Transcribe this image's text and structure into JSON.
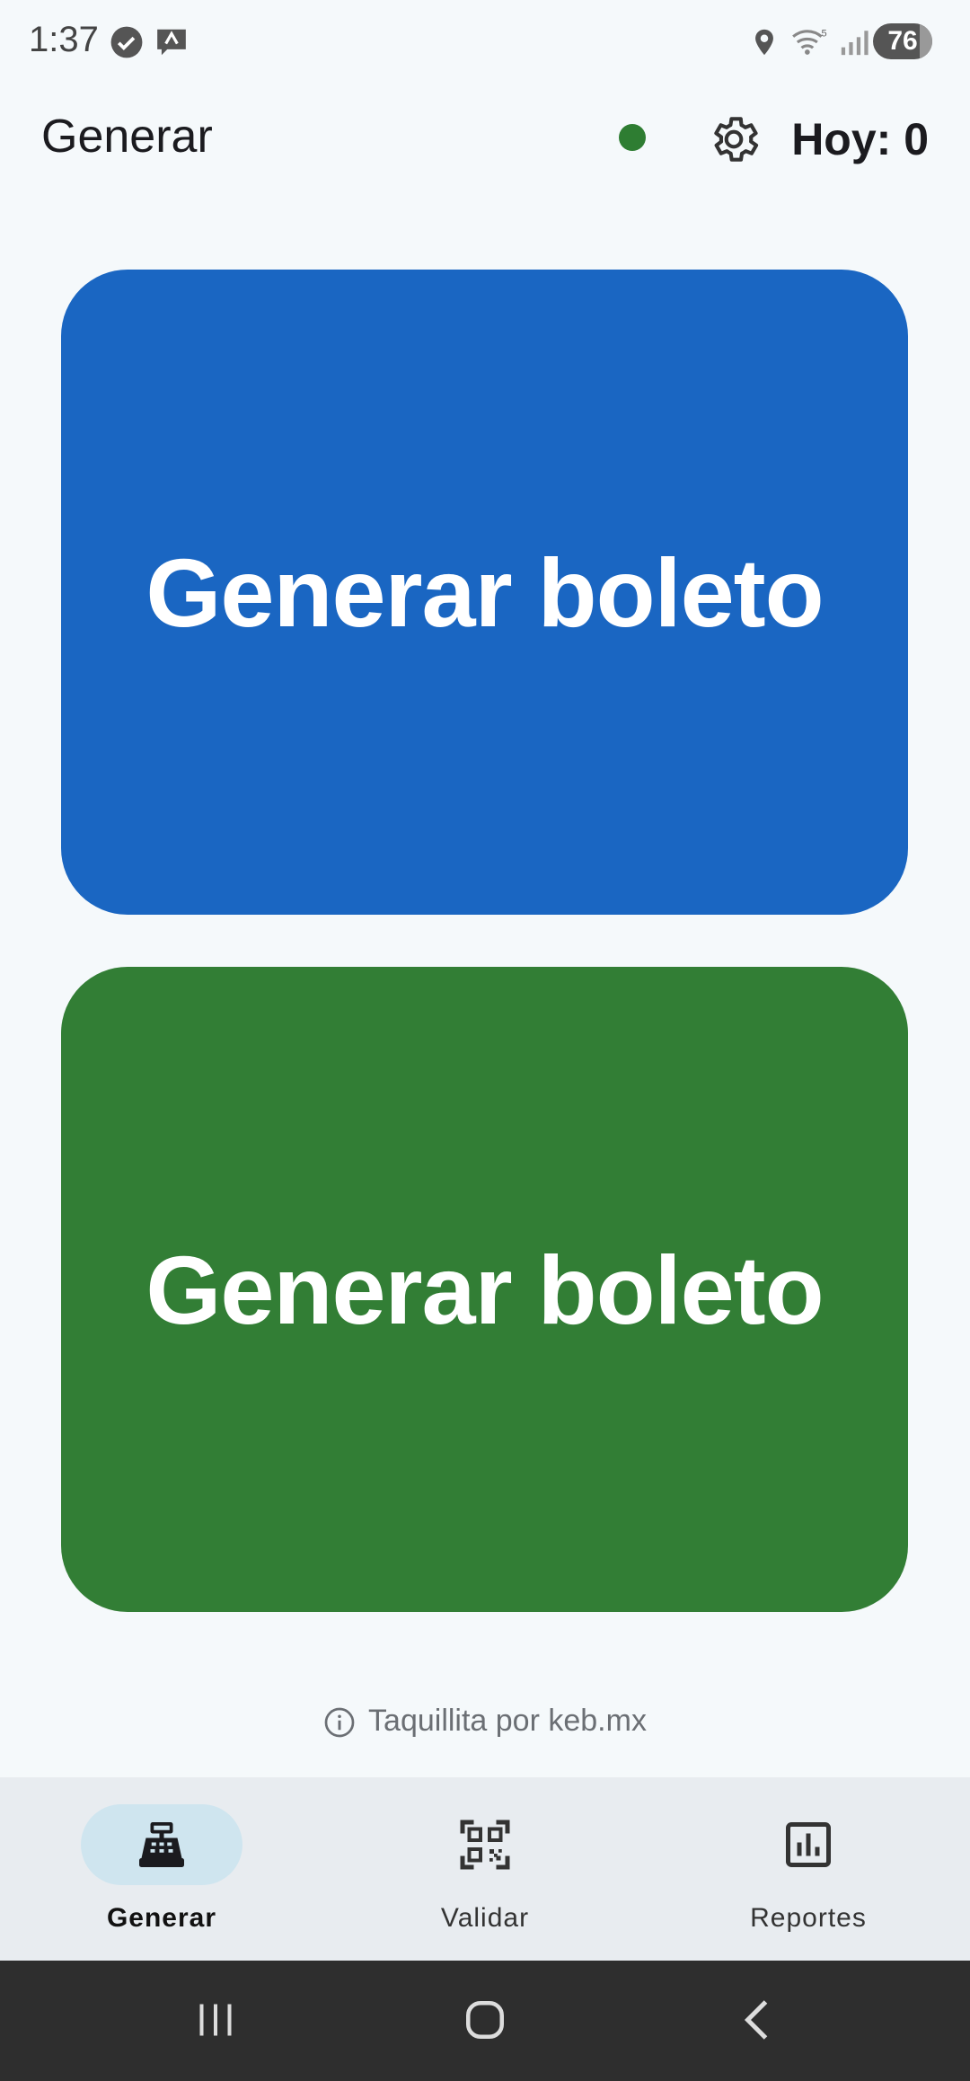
{
  "status_bar": {
    "time": "1:37",
    "battery": "76"
  },
  "app_bar": {
    "title": "Generar",
    "today_count": "Hoy: 0"
  },
  "buttons": [
    {
      "label": "Generar boleto",
      "color": "#1a66c2"
    },
    {
      "label": "Generar boleto",
      "color": "#327e35"
    }
  ],
  "footer": {
    "credit": "Taquillita por keb.mx"
  },
  "bottom_nav": {
    "items": [
      {
        "label": "Generar",
        "icon": "cash-register-icon",
        "active": true
      },
      {
        "label": "Validar",
        "icon": "qr-code-icon",
        "active": false
      },
      {
        "label": "Reportes",
        "icon": "bar-chart-icon",
        "active": false
      }
    ]
  },
  "colors": {
    "accent_blue": "#1a66c2",
    "accent_green": "#327e35",
    "status_dot": "#2e7d32",
    "nav_active_pill": "#cfe5ef"
  }
}
